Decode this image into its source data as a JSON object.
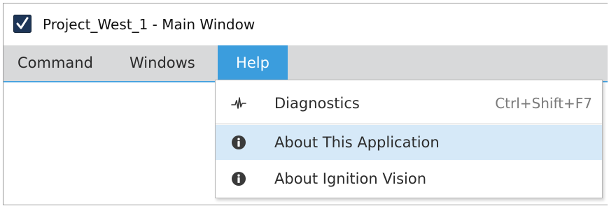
{
  "window": {
    "title": "Project_West_1 - Main Window",
    "icon": "checkmark-app-icon"
  },
  "menu_bar": {
    "items": [
      {
        "label": "Command"
      },
      {
        "label": "Windows"
      },
      {
        "label": "Help",
        "active": true
      }
    ]
  },
  "help_menu": {
    "items": [
      {
        "label": "Diagnostics",
        "shortcut": "Ctrl+Shift+F7",
        "icon": "waveform-icon"
      },
      {
        "label": "About This Application",
        "icon": "info-circle-icon",
        "highlighted": true
      },
      {
        "label": "About Ignition Vision",
        "icon": "info-circle-icon"
      }
    ]
  },
  "colors": {
    "menu_bar_bg": "#d8d9da",
    "active_menu_bg": "#3b9ddd",
    "highlight_bg": "#d6e9f8",
    "accent_line": "#4aa3df"
  }
}
